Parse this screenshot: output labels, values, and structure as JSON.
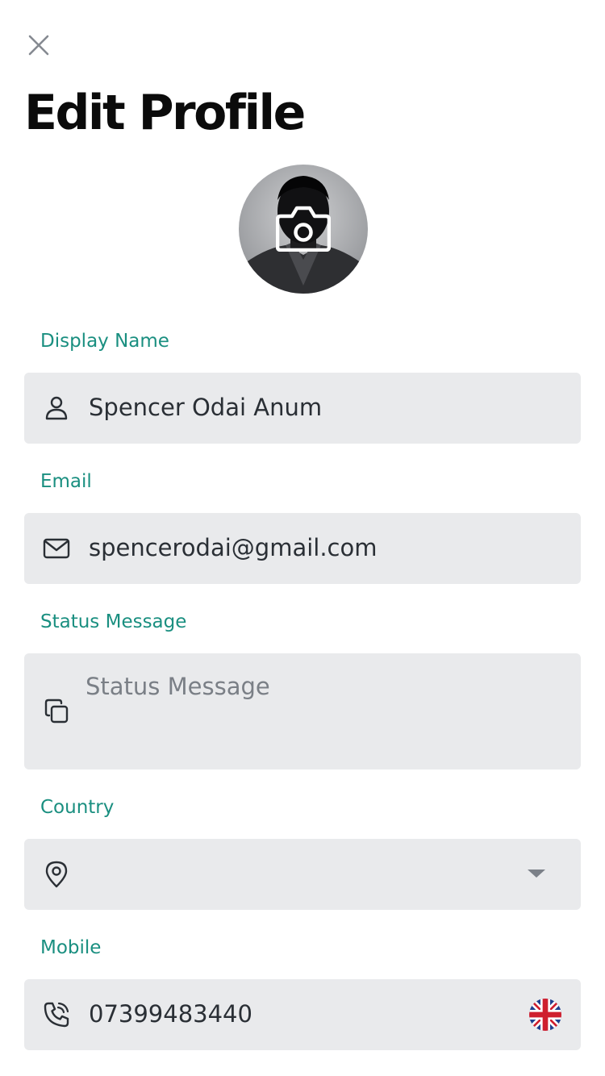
{
  "header": {
    "title": "Edit Profile",
    "close_icon": "close-icon"
  },
  "avatar": {
    "icon": "camera-icon"
  },
  "form": {
    "display_name": {
      "label": "Display Name",
      "value": "Spencer Odai Anum",
      "icon": "user-icon"
    },
    "email": {
      "label": "Email",
      "value": "spencerodai@gmail.com",
      "icon": "mail-icon"
    },
    "status": {
      "label": "Status Message",
      "value": "",
      "placeholder": "Status Message",
      "icon": "copy-icon"
    },
    "country": {
      "label": "Country",
      "value": "",
      "icon": "map-pin-icon",
      "caret_icon": "caret-down-icon"
    },
    "mobile": {
      "label": "Mobile",
      "value": "07399483440",
      "icon": "phone-icon",
      "flag_icon": "uk-flag-icon"
    }
  },
  "colors": {
    "accent": "#1a8f80",
    "field_bg": "#e9eaec",
    "text": "#2a2f35",
    "placeholder": "#7a7f86"
  }
}
